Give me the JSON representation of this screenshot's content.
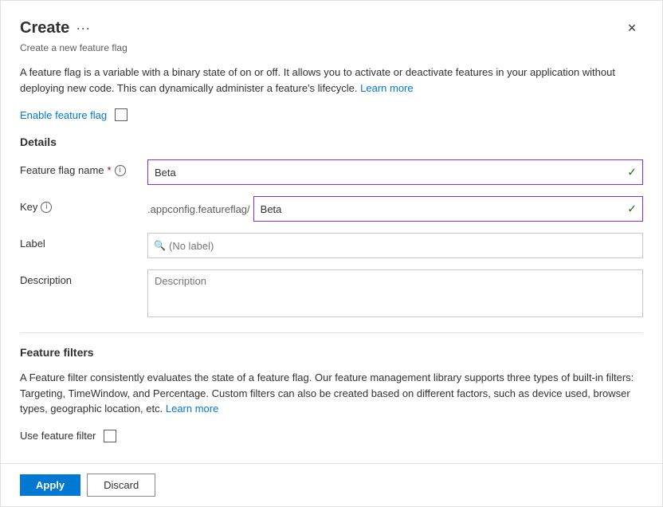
{
  "panel": {
    "title": "Create",
    "subtitle": "Create a new feature flag",
    "close_label": "×",
    "ellipsis": "···"
  },
  "intro": {
    "text1": "A feature flag is a variable with a binary state of on or off. It allows you to activate or deactivate features in your application without deploying new code. This can dynamically administer a feature's lifecycle.",
    "learn_more": "Learn more"
  },
  "enable": {
    "label": "Enable feature flag"
  },
  "details": {
    "section_title": "Details",
    "feature_flag_name_label": "Feature flag name",
    "feature_flag_name_value": "Beta",
    "key_label": "Key",
    "key_prefix": ".appconfig.featureflag/",
    "key_value": "Beta",
    "label_label": "Label",
    "label_placeholder": "(No label)",
    "description_label": "Description",
    "description_placeholder": "Description"
  },
  "feature_filters": {
    "section_title": "Feature filters",
    "description": "A Feature filter consistently evaluates the state of a feature flag. Our feature management library supports three types of built-in filters: Targeting, TimeWindow, and Percentage. Custom filters can also be created based on different factors, such as device used, browser types, geographic location, etc.",
    "learn_more": "Learn more",
    "use_filter_label": "Use feature filter"
  },
  "footer": {
    "apply_label": "Apply",
    "discard_label": "Discard"
  }
}
